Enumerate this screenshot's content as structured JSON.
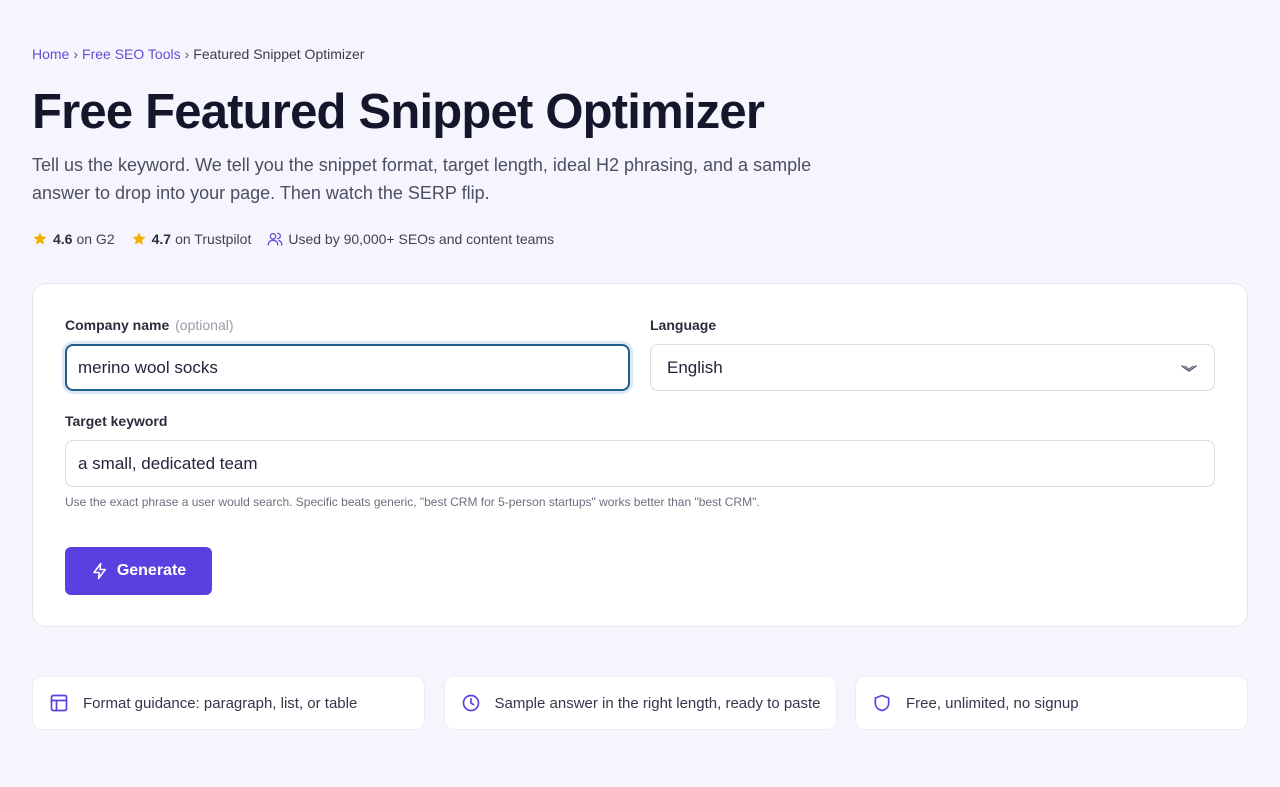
{
  "breadcrumb": {
    "home": "Home",
    "tools": "Free SEO Tools",
    "current": "Featured Snippet Optimizer",
    "separator": "›"
  },
  "page": {
    "title": "Free Featured Snippet Optimizer",
    "subtitle": "Tell us the keyword. We tell you the snippet format, target length, ideal H2 phrasing, and a sample answer to drop into your page. Then watch the SERP flip."
  },
  "ratings": {
    "g2_score": "4.6",
    "g2_label": "on G2",
    "trustpilot_score": "4.7",
    "trustpilot_label": "on Trustpilot",
    "usage": "Used by 90,000+ SEOs and content teams"
  },
  "form": {
    "company_label": "Company name",
    "company_optional": "(optional)",
    "company_value": "merino wool socks",
    "language_label": "Language",
    "language_value": "English",
    "keyword_label": "Target keyword",
    "keyword_value": "a small, dedicated team",
    "keyword_hint": "Use the exact phrase a user would search. Specific beats generic, \"best CRM for 5-person startups\" works better than \"best CRM\".",
    "generate_label": "Generate"
  },
  "features": [
    {
      "icon": "layout-icon",
      "text": "Format guidance: paragraph, list, or table"
    },
    {
      "icon": "clock-icon",
      "text": "Sample answer in the right length, ready to paste"
    },
    {
      "icon": "shield-icon",
      "text": "Free, unlimited, no signup"
    }
  ],
  "colors": {
    "accent": "#5b3fe0",
    "link": "#6a4bd6",
    "star": "#f2b000",
    "focus_border": "#1f5f8b",
    "background": "#f6f5fd"
  }
}
